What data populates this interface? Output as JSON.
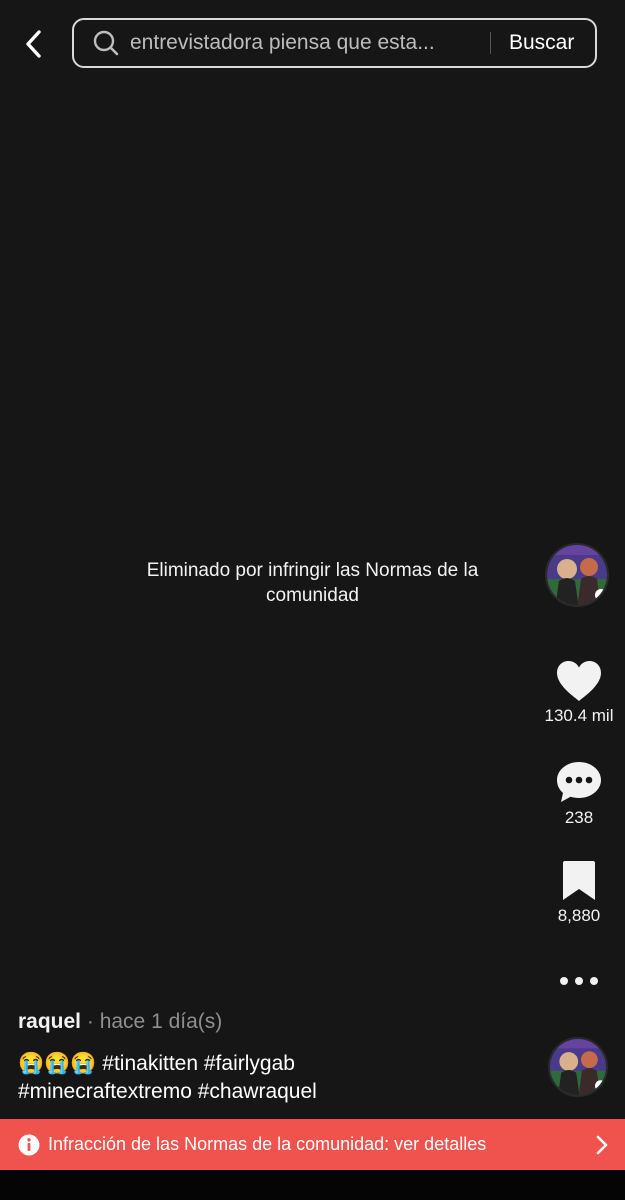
{
  "search": {
    "query": "entrevistadora piensa que esta...",
    "button_label": "Buscar"
  },
  "video": {
    "removed_message": "Eliminado por infringir las Normas de la comunidad"
  },
  "actions": {
    "likes": "130.4 mil",
    "comments": "238",
    "saves": "8,880"
  },
  "post": {
    "author": "raquel",
    "time": " · hace 1 día(s)",
    "emojis": "😭😭😭",
    "hashtags": [
      "#tinakitten",
      "#fairlygab",
      "#minecraftextremo",
      "#chawraquel"
    ]
  },
  "banner": {
    "text": "Infracción de las Normas de la comunidad: ver detalles"
  },
  "colors": {
    "background": "#161616",
    "banner": "#f0524d"
  }
}
